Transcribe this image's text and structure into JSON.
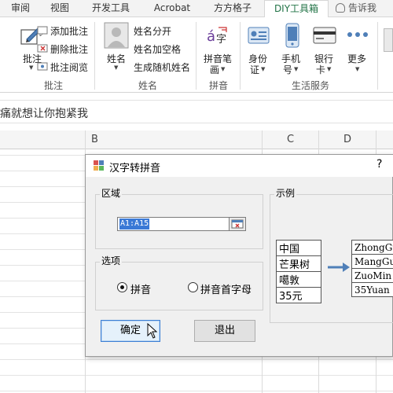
{
  "ribbon_tabs": [
    "审阅",
    "视图",
    "开发工具",
    "Acrobat",
    "方方格子",
    "DIY工具箱"
  ],
  "active_tab": "DIY工具箱",
  "tell_me": "告诉我",
  "groups": {
    "annotation": {
      "label": "批注",
      "big_button": "批注",
      "items": [
        "添加批注",
        "删除批注",
        "批注阅览"
      ]
    },
    "name": {
      "label": "姓名",
      "big_button": "姓名",
      "items": [
        "姓名分开",
        "姓名加空格",
        "生成随机姓名"
      ]
    },
    "pinyin": {
      "label": "拼音",
      "big_button_line1": "拼音笔",
      "big_button_line2": "画"
    },
    "life_service": {
      "label": "生活服务",
      "buttons": [
        {
          "line1": "身份",
          "line2": "证"
        },
        {
          "line1": "手机",
          "line2": "号"
        },
        {
          "line1": "银行",
          "line2": "卡"
        },
        {
          "line1": "更多",
          "line2": ""
        }
      ]
    }
  },
  "formula_bar_text": "痛就想让你抱紧我",
  "columns": [
    "B",
    "C",
    "D"
  ],
  "dialog": {
    "title": "汉字转拼音",
    "help": "?",
    "range_section": "区域",
    "range_value": "A1:A15",
    "options_section": "选项",
    "options": [
      {
        "label": "拼音",
        "checked": true
      },
      {
        "label": "拼音首字母",
        "checked": false
      }
    ],
    "ok_button": "确定",
    "exit_button": "退出",
    "example_section": "示例",
    "example_input": [
      "中国",
      "芒果树",
      "噶敦",
      "35元"
    ],
    "example_output": [
      "ZhongGu",
      "MangGu",
      "ZuoMin",
      "35Yuan"
    ]
  },
  "colors": {
    "accent_green": "#217346",
    "selection_blue": "#3a79d6",
    "arrow_blue": "#4f7fb8"
  }
}
